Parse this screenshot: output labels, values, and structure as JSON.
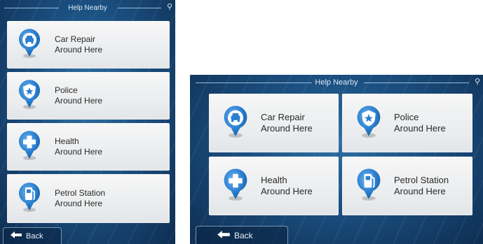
{
  "left_screen": {
    "title": "Help Nearby",
    "back_label": "Back",
    "tiles": [
      {
        "line1": "Car Repair",
        "line2": "Around Here"
      },
      {
        "line1": "Police",
        "line2": "Around Here"
      },
      {
        "line1": "Health",
        "line2": "Around Here"
      },
      {
        "line1": "Petrol Station",
        "line2": "Around Here"
      }
    ]
  },
  "right_screen": {
    "title": "Help Nearby",
    "back_label": "Back",
    "tiles": [
      {
        "line1": "Car Repair",
        "line2": "Around Here"
      },
      {
        "line1": "Police",
        "line2": "Around Here"
      },
      {
        "line1": "Health",
        "line2": "Around Here"
      },
      {
        "line1": "Petrol Station",
        "line2": "Around Here"
      }
    ]
  },
  "icons": {
    "status": "satellite-icon",
    "car_repair": "car-icon",
    "police": "police-badge-icon",
    "health": "medical-cross-icon",
    "petrol": "fuel-pump-icon",
    "back": "back-arrow-icon"
  },
  "colors": {
    "pin_blue": "#2a7fd0",
    "background": "#1b4f80",
    "tile": "#eceef0"
  }
}
